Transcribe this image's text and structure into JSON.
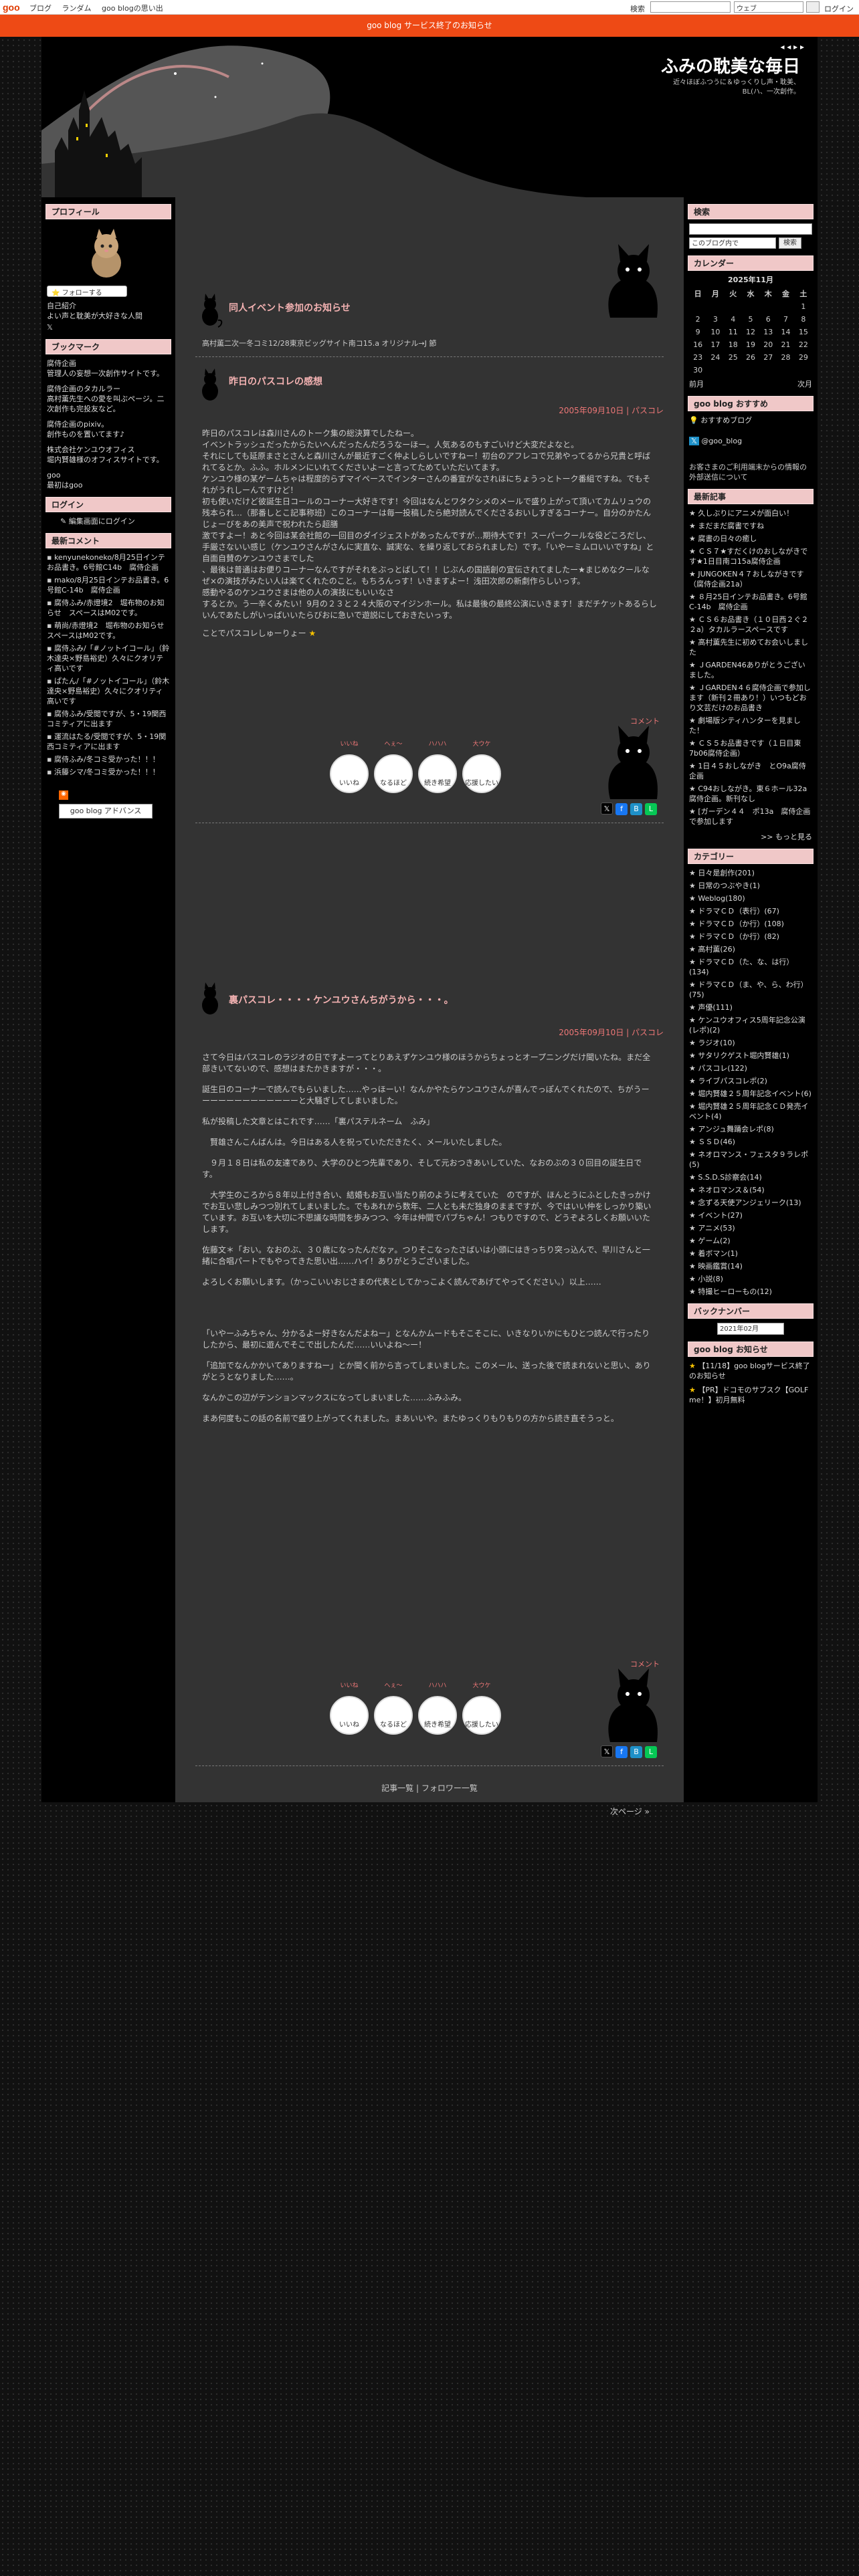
{
  "topbar": {
    "logo": "goo",
    "links": [
      "ブログ",
      "ランダム",
      "goo blogの思い出"
    ],
    "search_label": "検索",
    "search_select": "ウェブ",
    "login": "ログイン"
  },
  "notice": "goo blog サービス終了のお知らせ",
  "header": {
    "title": "ふみの耽美な毎日",
    "nav": "◂ ◂ ▸ ▸",
    "tagline": "近々ほぼふつうに＆ゆっくりし声・耽美、BL(ハ、一次創作。"
  },
  "left_sidebar": {
    "profile_title": "プロフィール",
    "follow_label": "フォローする",
    "profile_links": [
      "自己紹介",
      "よい声と耽美が大好きな人間"
    ],
    "bookmark_title": "ブックマーク",
    "bookmarks": [
      "腐侍企画",
      "管理人の妄想一次創作サイトです。",
      "腐侍企画のタカルラー",
      "高村薫先生への愛を叫ぶページ。二次創作も完投友など。",
      "腐侍企画のpixiv。",
      "創作ものを置いてます♪",
      "株式会社ケンユウオフィス",
      "堀内賢雄様のオフィスサイトです。",
      "goo",
      "最初はgoo"
    ],
    "login_title": "ログイン",
    "login_link": "編集画面にログイン",
    "comments_title": "最新コメント",
    "comments": [
      "kenyunekoneko/8月25日インテお品書き。6号館C14b　腐侍企画",
      "mako/8月25日インテお品書き。6号館C-14b　腐侍企画",
      "腐侍ふみ/赤燈境2　堀布物のお知らせ　スペースはM02です。",
      "萌尚/赤燈境2　堀布物のお知らせ　スペースはM02です。",
      "腐侍ふみ/「#ノットイコール」（鈴木達央×野島裕史）久々にクオリティ高いです",
      "ぱたん/「#ノットイコール」（鈴木達央×野島裕史）久々にクオリティ高いです",
      "腐侍ふみ/受閲ですが、5・19関西コミティアに出ます",
      "運流はたる/受閲ですが、5・19関西コミティアに出ます",
      "腐侍ふみ/冬コミ受かった！！！",
      "浜籐シマ/冬コミ受かった！！！"
    ],
    "adpanel": "goo blog アドバンス"
  },
  "main": {
    "teaser": {
      "title": "同人イベント参加のお知らせ",
      "text": "高村薫二次一冬コミ12/28東京ビッグサイト南コ15.a オリジナル→J 節"
    },
    "post1": {
      "title": "昨日のパスコレの感想",
      "meta": "2005年09月10日 | パスコレ",
      "paragraphs": [
        "昨日のパスコレは森川さんのトーク集の総決算でしたねー。",
        "イベントラッシュだったからたいへんだったんだろうなーほー。人気あるのもすごいけど大変だよなと。",
        "それにしても延原まさとさんと森川さんが最近すごく仲よしらしいですねー！初台のアフレコで兄弟やってるから兄貴と呼ばれてるとか。ふふ。ホルメンにいれてくださいよーと言ってためていただいてます。",
        "ケンユウ様の某ゲームちゃは程度的らずマイペースでインターさんの番宣がなされほにちょうっとトーク番組ですね。でもそれがうれしーんですけど！",
        "初も使いだけど彼誕生日コールのコーナー大好きです！今回はなんとワタクシメのメールで盛り上がって頂いてカムリュウの残本られ…（那番しとこ記事称班）このコーナーは毎一投稿したら絶対読んでくださるおいしすぎるコーナー。自分のかたんじょーびをあの美声で祝われたら超膳",
        "激ですよー！あと今回は某会社館の一回目のダイジェストがあったんですが…期待大です！スーパークールな役どころだし、手厳さないい感じ（ケンユウさんがさんに実直な、誠実な、を繰り返しておられました）です。「いやーミムロいいですね」と自面自賛のケンユウさまでした",
        "、最後は普通はお便りコーナーなんですがそれをぶっとばして！！じぶんの国語創の宣伝されてましたー★まじめなクールなぜ×の演技がみたい人は楽てくれたのこと。もちろんっす！いきますよー！浅田次郎の新劇作らしいっす。",
        "感動やるのケンユウさまは他の人の演技にもいいなさ",
        "するとか。う一辛くみたい！9月の２３と２４大阪のマイジンホール。私は最後の最終公演にいきます！まだチケットあるらしいんであたしがいっぱいいたらびおに急いで遊説にしておきたいっす。",
        "ことでパスコレしゅーりょー"
      ],
      "comment_label": "コメント"
    },
    "reactions": [
      {
        "head": "いいね",
        "label": "いいね"
      },
      {
        "head": "へぇ～",
        "label": "なるほど"
      },
      {
        "head": "ハハハ",
        "label": "続き希望"
      },
      {
        "head": "大ウケ",
        "label": "応援したい"
      }
    ],
    "post2": {
      "title": "裏パスコレ・・・・ケンユウさんちがうから・・・。",
      "meta": "2005年09月10日 | パスコレ",
      "paragraphs": [
        "さて今日はパスコレのラジオの日ですよーってとりあえずケンユウ様のほうからちょっとオープニングだけ聞いたね。まだ全部きいてないので、感想はまたかきますが・・・。",
        "誕生日のコーナーで読んでもらいました……やっほーい！なんかやたらケンユウさんが喜んでっぽんでくれたので、ちがうーーーーーーーーーーーーーと大騒ぎしてしまいました。",
        "私が投稿した文章とはこれです……「裏パステルネーム　ふみ」",
        "　賢雄さんこんばんは。今日はある人を祝っていただきたく、メールいたしました。",
        "　９月１８日は私の友達であり、大学のひとつ先輩であり、そして元おつきあいしていた、なおのぶの３０回目の誕生日です。",
        "　大学生のころから８年以上付き合い、結婚もお互い当たり前のように考えていた　のですが、ほんとうにふとしたきっかけでお互い悲しみつつ別れてしまいました。でもあれから数年、二人とも未だ独身のままですが、今ではいい仲をしっかり築いています。お互いを大切に不思議な時間を歩みつつ、今年は仲間でパブちゃん！つもりですので、どうぞよろしくお願いいたします。",
        "佐藤文＊「おい。なおのぶ、３０歳になったんだなァ。つりそこなったさばいは小頭にはきっちり突っ込んで、早川さんと一緒に合唱パートでもやってきた思い出……ハイ！ありがとうございました。",
        "よろしくお願いします。（かっこいいおじさまの代表としてかっこよく読んであげてやってください。）以上……",
        "「いやーふみちゃん、分かるよー好きなんだよねー」となんかムードもそこそこに、いきなりいかにもひとつ読んで行ったりしたから、最初に遊んでそこで出したんだ……いいよね〜ー！",
        "「追加でなんかかいてありますねー」とか聞く前から言ってしまいました。このメール、送った後で読まれないと思い、ありがとうとなりました……。",
        "なんかこの辺がテンションマックスになってしまいました……ふみふみ。",
        "まあ何度もこの話の名前で盛り上がってくれました。まあいいや。またゆっくりもりもりの方から読き直そうっと。"
      ],
      "comment_label": "コメント"
    },
    "bottom_links": "記事一覧 | フォロワー一覧",
    "next_link": "次ページ »"
  },
  "right_sidebar": {
    "search_title": "検索",
    "search_select": "このブログ内で",
    "search_button": "検索",
    "calendar_title": "カレンダー",
    "calendar_month": "2025年11月",
    "weekdays": [
      "日",
      "月",
      "火",
      "水",
      "木",
      "金",
      "土"
    ],
    "calendar_rows": [
      [
        "",
        "",
        "",
        "",
        "",
        "",
        "1"
      ],
      [
        "2",
        "3",
        "4",
        "5",
        "6",
        "7",
        "8"
      ],
      [
        "9",
        "10",
        "11",
        "12",
        "13",
        "14",
        "15"
      ],
      [
        "16",
        "17",
        "18",
        "19",
        "20",
        "21",
        "22"
      ],
      [
        "23",
        "24",
        "25",
        "26",
        "27",
        "28",
        "29"
      ],
      [
        "30",
        "",
        "",
        "",
        "",
        "",
        ""
      ]
    ],
    "cal_prev": "前月",
    "cal_next": "次月",
    "goo_blog_title": "goo blog おすすめ",
    "goo_blog_item": "おすすめブログ",
    "goo_blog_x": "@goo_blog",
    "notice_text": "お客さまのご利用端末からの情報の外部送信について",
    "recent_title": "最新記事",
    "recent": [
      "久しぶりにアニメが面白い！",
      "まだまだ腐書ですね",
      "腐書の日々の癒し",
      "ＣＳ７★すだくけのおしながきです★1日目南コ15a腐侍企画",
      "JUNGOKEN４７おしながきです（腐侍企画21a）",
      "８月25日インテお品書き。6号館C-14b　腐侍企画",
      "ＣＳ６お品書き（１０日西２ぐ２２a）タカルラースペースです",
      "高村薫先生に初めてお会いしました",
      "ＪGARDEN46ありがとうございました。",
      "ＪGARDEN４６腐侍企画で参加します（新刊２冊あり！）いつもどおり文芸だけのお品書き",
      "劇場版シティハンターを見ました！",
      "ＣＳ５お品書きです（１日目東7b06腐侍企画）",
      "1日４５おしながき　とO9a腐侍企画",
      "C94おしながき。東６ホール32a腐侍企画。新刊なし",
      "[ガーデン４４　ポ13a　腐侍企画で参加します"
    ],
    "recent_more": ">> もっと見る",
    "category_title": "カテゴリー",
    "categories": [
      "日々是創作(201)",
      "日常のつぶやき(1)",
      "Weblog(180)",
      "ドラマＣＤ（表行）(67)",
      "ドラマＣＤ（か行）(108)",
      "ドラマＣＤ（か行）(82)",
      "高村薫(26)",
      "ドラマＣＤ（た、な、は行）(134)",
      "ドラマＣＤ（ま、や、ら、わ行）(75)",
      "声優(111)",
      "ケンユウオフィス5周年記念公演(レポ)(2)",
      "ラジオ(10)",
      "サタリクゲスト堀内賢雄(1)",
      "パスコレ(122)",
      "ライブパスコレポ(2)",
      "堀内賢雄２５周年記念イベント(6)",
      "堀内賢雄２５周年記念ＣＤ発売イベント(4)",
      "アンジュ舞踊会レポ(8)",
      "ＳＳＤ(46)",
      "ネオロマンス・フェスタ９ラレポ(5)",
      "S.S.D.S診察会(14)",
      "ネオロマンス＆(54)",
      "念ずる天使アンジェリーク(13)",
      "イベント(27)",
      "アニメ(53)",
      "ゲーム(2)",
      "着ボマン(1)",
      "映画鑑賞(14)",
      "小説(8)",
      "特撮ヒーローもの(12)"
    ],
    "backnumber_title": "バックナンバー",
    "backnumber_select": "2021年02月",
    "goo_notice_title": "goo blog お知らせ",
    "goo_notice": [
      "【11/18】goo blogサービス終了のお知らせ",
      "【PR】ドコモのサブスク【GOLF me！】初月無料"
    ]
  }
}
